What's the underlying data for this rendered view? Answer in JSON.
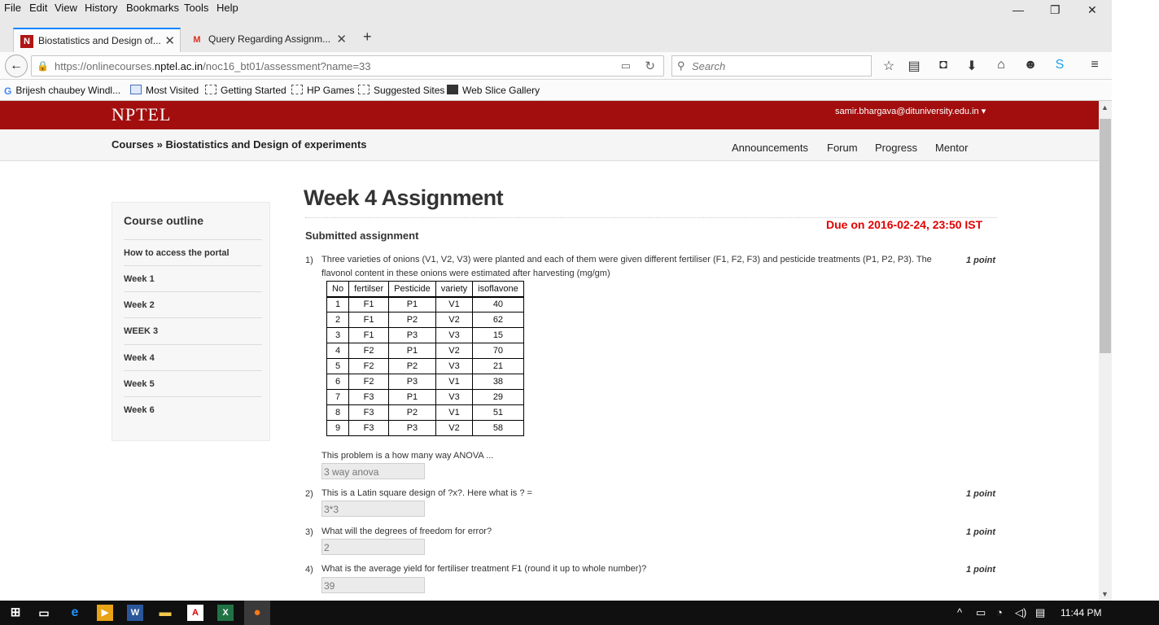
{
  "menu": [
    "File",
    "Edit",
    "View",
    "History",
    "Bookmarks",
    "Tools",
    "Help"
  ],
  "window_controls": {
    "minimize": "—",
    "restore": "❐",
    "close": "✕"
  },
  "tabs": [
    {
      "favicon": "N",
      "label": "Biostatistics and Design of..."
    },
    {
      "favicon": "M",
      "label": "Query Regarding Assignm..."
    }
  ],
  "new_tab_label": "+",
  "url": {
    "prefix": "https://onlinecourses.",
    "host": "nptel.ac.in",
    "path": "/noc16_bt01/assessment?name=33"
  },
  "search": {
    "placeholder": "Search"
  },
  "bookmarks": [
    "Brijesh chaubey Windl...",
    "Most Visited",
    "Getting Started",
    "HP Games",
    "Suggested Sites",
    "Web Slice Gallery"
  ],
  "site": {
    "logo": "NPTEL",
    "user_email": "samir.bhargava@dituniversity.edu.in ▾",
    "breadcrumb": "Courses  »  Biostatistics and Design of experiments",
    "nav": [
      "Announcements",
      "Forum",
      "Progress",
      "Mentor"
    ]
  },
  "sidebar": {
    "title": "Course outline",
    "items": [
      "How to access the portal",
      "Week 1",
      "Week 2",
      "WEEK 3",
      "Week 4",
      "Week 5",
      "Week 6"
    ]
  },
  "assignment": {
    "title": "Week 4 Assignment",
    "due": "Due on 2016-02-24, 23:50 IST",
    "status": "Submitted assignment"
  },
  "questions": [
    {
      "num": "1)",
      "text": "Three varieties of onions (V1, V2, V3) were planted and each of them were given different fertiliser (F1, F2, F3) and pesticide treatments (P1, P2, P3). The flavonol content in these onions were estimated after harvesting (mg/gm)",
      "points": "1 point",
      "subtext": "This problem is a how many way ANOVA  ...",
      "answer": "3 way anova"
    },
    {
      "num": "2)",
      "text": "This is a Latin square design of ?x?. Here what is ? =",
      "points": "1 point",
      "answer": "3*3"
    },
    {
      "num": "3)",
      "text": "What will the degrees of freedom for error?",
      "points": "1 point",
      "answer": "2"
    },
    {
      "num": "4)",
      "text": "What is the average yield for fertiliser treatment F1 (round it up to whole number)?",
      "points": "1 point",
      "answer": "39"
    }
  ],
  "table": {
    "headers": [
      "No",
      "fertilser",
      "Pesticide",
      "variety",
      "isoflavone"
    ],
    "rows": [
      [
        "1",
        "F1",
        "P1",
        "V1",
        "40"
      ],
      [
        "2",
        "F1",
        "P2",
        "V2",
        "62"
      ],
      [
        "3",
        "F1",
        "P3",
        "V3",
        "15"
      ],
      [
        "4",
        "F2",
        "P1",
        "V2",
        "70"
      ],
      [
        "5",
        "F2",
        "P2",
        "V3",
        "21"
      ],
      [
        "6",
        "F2",
        "P3",
        "V1",
        "38"
      ],
      [
        "7",
        "F3",
        "P1",
        "V3",
        "29"
      ],
      [
        "8",
        "F3",
        "P2",
        "V1",
        "51"
      ],
      [
        "9",
        "F3",
        "P3",
        "V2",
        "58"
      ]
    ]
  },
  "taskbar": {
    "clock": "11:44 PM"
  }
}
